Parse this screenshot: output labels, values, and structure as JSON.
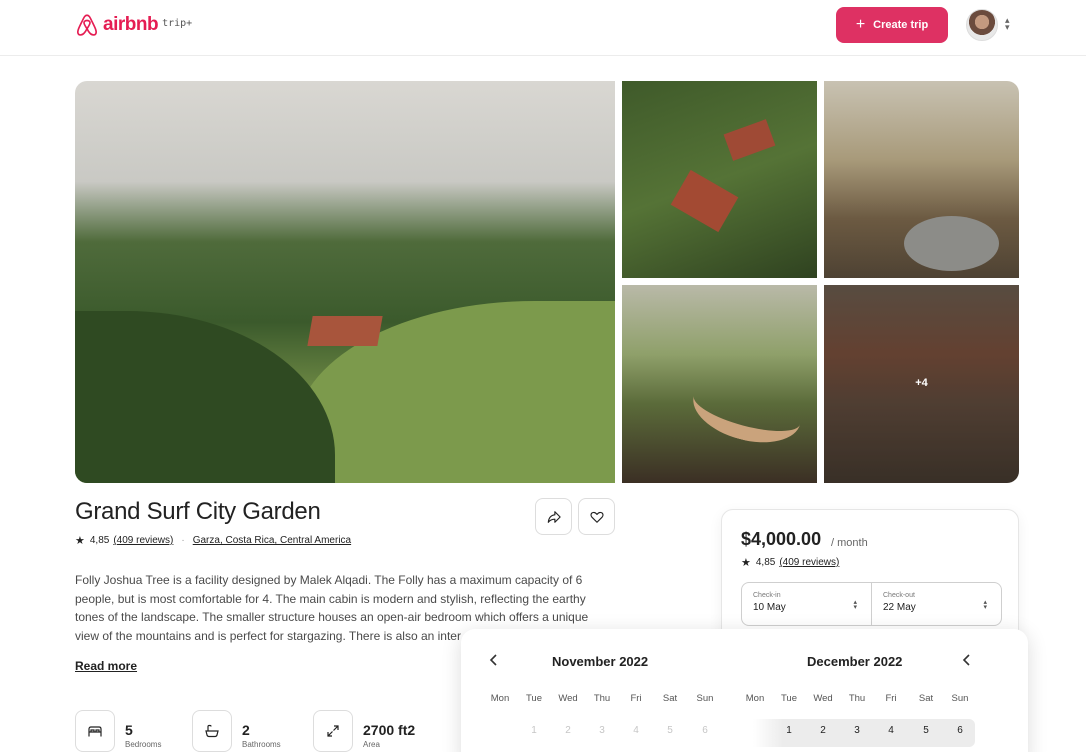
{
  "header": {
    "logo_text": "airbnb",
    "logo_sub": "trip+",
    "create_label": "Create trip",
    "create_icon": "plus-icon",
    "brand_color": "#de3163"
  },
  "gallery": {
    "more_label": "+4"
  },
  "listing": {
    "title": "Grand Surf City Garden",
    "rating": "4,85",
    "reviews": "(409 reviews)",
    "location": "Garza, Costa Rica, Central America",
    "description": "Folly Joshua Tree is a facility designed by Malek Alqadi. The Folly has a maximum capacity of 6 people, but is most comfortable for 4. The main cabin is modern and stylish, reflecting the earthy tones of the landscape. The smaller structure houses an open-air bedroom which offers a unique view of the mountains and is perfect for stargazing. There is also an inter",
    "read_more": "Read more",
    "features": [
      {
        "value": "5",
        "label": "Bedrooms",
        "icon": "bed-icon"
      },
      {
        "value": "2",
        "label": "Bathrooms",
        "icon": "bath-icon"
      },
      {
        "value": "2700 ft2",
        "label": "Area",
        "icon": "expand-icon"
      }
    ]
  },
  "booking": {
    "price": "$4,000.00",
    "per": "/ month",
    "rating": "4,85",
    "reviews": "(409 reviews)",
    "checkin_label": "Check-in",
    "checkin_value": "10 May",
    "checkout_label": "Check-out",
    "checkout_value": "22 May"
  },
  "calendar": {
    "months": [
      {
        "title": "November 2022",
        "weekdays": [
          "Mon",
          "Tue",
          "Wed",
          "Thu",
          "Fri",
          "Sat",
          "Sun"
        ],
        "days": [
          "",
          "1",
          "2",
          "3",
          "4",
          "5",
          "6"
        ]
      },
      {
        "title": "December 2022",
        "weekdays": [
          "Mon",
          "Tue",
          "Wed",
          "Thu",
          "Fri",
          "Sat",
          "Sun"
        ],
        "days": [
          "",
          "1",
          "2",
          "3",
          "4",
          "5",
          "6"
        ]
      }
    ]
  }
}
